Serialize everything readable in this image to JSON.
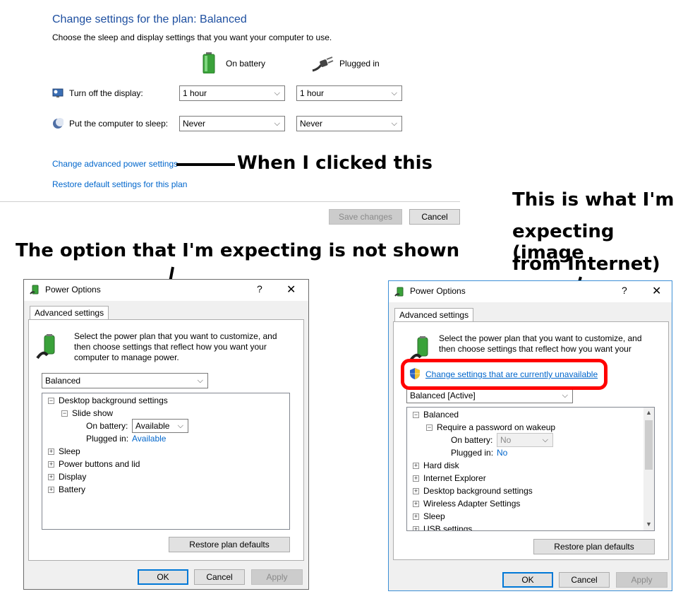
{
  "plan": {
    "title": "Change settings for the plan: Balanced",
    "description": "Choose the sleep and display settings that you want your computer to use.",
    "col_battery": "On battery",
    "col_plugged": "Plugged in",
    "rows": [
      {
        "label": "Turn off the display:",
        "battery": "1 hour",
        "plugged": "1 hour"
      },
      {
        "label": "Put the computer to sleep:",
        "battery": "Never",
        "plugged": "Never"
      }
    ],
    "advanced_link": "Change advanced power settings",
    "restore_link": "Restore default settings for this plan",
    "save_button": "Save changes",
    "cancel_button": "Cancel"
  },
  "annotations": {
    "clicked": "When I clicked this",
    "expecting_line1": "This is what I'm",
    "expecting_line2": "expecting (image",
    "expecting_line3": "from Internet)",
    "not_shown": "The option that I'm expecting is not shown"
  },
  "dialog_left": {
    "title": "Power Options",
    "help": "?",
    "close": "✕",
    "tab": "Advanced settings",
    "intro": "Select the power plan that you want to customize, and then choose settings that reflect how you want your computer to manage power.",
    "plan_select": "Balanced",
    "tree": {
      "item1": "Desktop background settings",
      "item1_child": "Slide show",
      "on_battery_label": "On battery:",
      "on_battery_value": "Available",
      "plugged_label": "Plugged in:",
      "plugged_value": "Available",
      "item2": "Sleep",
      "item3": "Power buttons and lid",
      "item4": "Display",
      "item5": "Battery"
    },
    "restore_button": "Restore plan defaults",
    "ok": "OK",
    "cancel": "Cancel",
    "apply": "Apply"
  },
  "dialog_right": {
    "title": "Power Options",
    "help": "?",
    "close": "✕",
    "tab": "Advanced settings",
    "intro": "Select the power plan that you want to customize, and then choose settings that reflect how you want your",
    "unavailable_link": "Change settings that are currently unavailable",
    "plan_select": "Balanced [Active]",
    "tree": {
      "item1": "Balanced",
      "item1_child": "Require a password on wakeup",
      "on_battery_label": "On battery:",
      "on_battery_value": "No",
      "plugged_label": "Plugged in:",
      "plugged_value": "No",
      "item2": "Hard disk",
      "item3": "Internet Explorer",
      "item4": "Desktop background settings",
      "item5": "Wireless Adapter Settings",
      "item6": "Sleep",
      "item7": "USB settings"
    },
    "restore_button": "Restore plan defaults",
    "ok": "OK",
    "cancel": "Cancel",
    "apply": "Apply"
  },
  "colors": {
    "link": "#0066cc",
    "title_blue": "#1e4fa0",
    "highlight_red": "#ff0000",
    "focus_blue": "#0078d7"
  }
}
